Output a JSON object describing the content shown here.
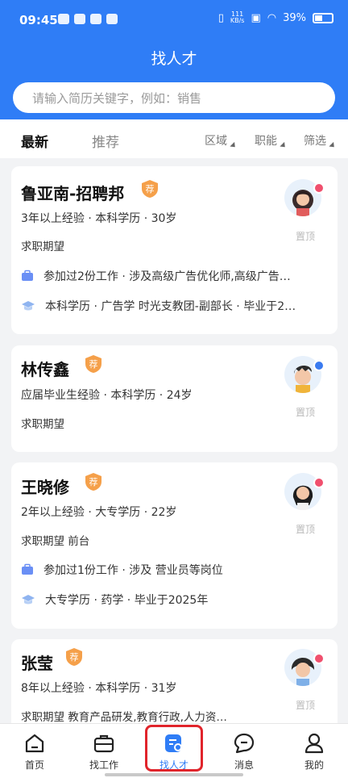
{
  "status": {
    "time": "09:45",
    "speed_top": "111",
    "speed_unit": "KB/s",
    "battery": "39%"
  },
  "header": {
    "title": "找人才"
  },
  "search": {
    "placeholder": "请输入简历关键字，例如：销售"
  },
  "tabs": [
    {
      "label": "最新",
      "active": true
    },
    {
      "label": "推荐",
      "active": false
    }
  ],
  "filters": [
    {
      "label": "区域"
    },
    {
      "label": "职能"
    },
    {
      "label": "筛选"
    }
  ],
  "badge_text": "荐",
  "pin_label": "置顶",
  "candidates": [
    {
      "name": "鲁亚南-招聘邦",
      "meta": "3年以上经验 · 本科学历 · 30岁",
      "expect": "求职期望",
      "work": "参加过2份工作 · 涉及高级广告优化师,高级广告…",
      "edu": "本科学历 · 广告学 时光支教团-副部长 · 毕业于2…",
      "gender": "female"
    },
    {
      "name": "林传鑫",
      "meta": "应届毕业生经验 · 本科学历 · 24岁",
      "expect": "求职期望",
      "gender": "male"
    },
    {
      "name": "王晓修",
      "meta": "2年以上经验 · 大专学历 · 22岁",
      "expect": "求职期望 前台",
      "work": "参加过1份工作 · 涉及 营业员等岗位",
      "edu": "大专学历 · 药学 · 毕业于2025年",
      "gender": "female"
    },
    {
      "name": "张莹",
      "meta": "8年以上经验 · 本科学历 · 31岁",
      "expect": "求职期望 教育产品研发,教育行政,人力资…",
      "gender": "female"
    }
  ],
  "nav": [
    {
      "label": "首页",
      "icon": "home-icon"
    },
    {
      "label": "找工作",
      "icon": "briefcase-icon"
    },
    {
      "label": "找人才",
      "icon": "talent-search-icon",
      "active": true
    },
    {
      "label": "消息",
      "icon": "message-icon"
    },
    {
      "label": "我的",
      "icon": "profile-icon"
    }
  ],
  "colors": {
    "primary": "#2f7df6",
    "badge": "#f5a04a",
    "female": "#f0506e",
    "male": "#3a7bf0",
    "highlight": "#e0242b"
  }
}
